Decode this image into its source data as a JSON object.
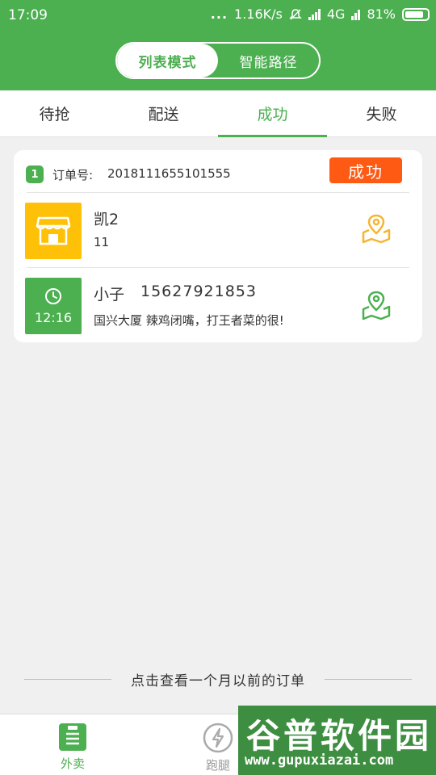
{
  "status_bar": {
    "time": "17:09",
    "dots": "...",
    "net_speed": "1.16K/s",
    "network": "4G",
    "battery": "81%"
  },
  "header": {
    "modes": [
      {
        "label": "列表模式",
        "active": true
      },
      {
        "label": "智能路径",
        "active": false
      }
    ]
  },
  "tabs": [
    {
      "label": "待抢",
      "active": false
    },
    {
      "label": "配送",
      "active": false
    },
    {
      "label": "成功",
      "active": true
    },
    {
      "label": "失败",
      "active": false
    }
  ],
  "order": {
    "index": "1",
    "order_label": "订单号:",
    "order_no": "2018111655101555",
    "status": "成功",
    "status_color": "#ff5a14",
    "shop": {
      "name": "凯2",
      "detail": "11",
      "icon": "store-icon",
      "icon_color": "#ffc107",
      "map_icon_color": "#f5b52e"
    },
    "customer": {
      "name": "小子",
      "phone": "15627921853",
      "address": "国兴大厦 辣鸡闭嘴，打王者菜的很!",
      "time": "12:16",
      "icon": "clock-icon",
      "map_icon_color": "#4caf50"
    }
  },
  "history_link": "点击查看一个月以前的订单",
  "bottom_nav": [
    {
      "label": "外卖",
      "icon": "takeout-list-icon",
      "active": true
    },
    {
      "label": "跑腿",
      "icon": "lightning-icon",
      "active": false
    }
  ],
  "watermark": {
    "cn": "谷普软件园",
    "en": "www.gupuxiazai.com"
  },
  "colors": {
    "brand_green": "#4caf50",
    "success_orange": "#ff5a14",
    "shop_yellow": "#ffc107"
  }
}
